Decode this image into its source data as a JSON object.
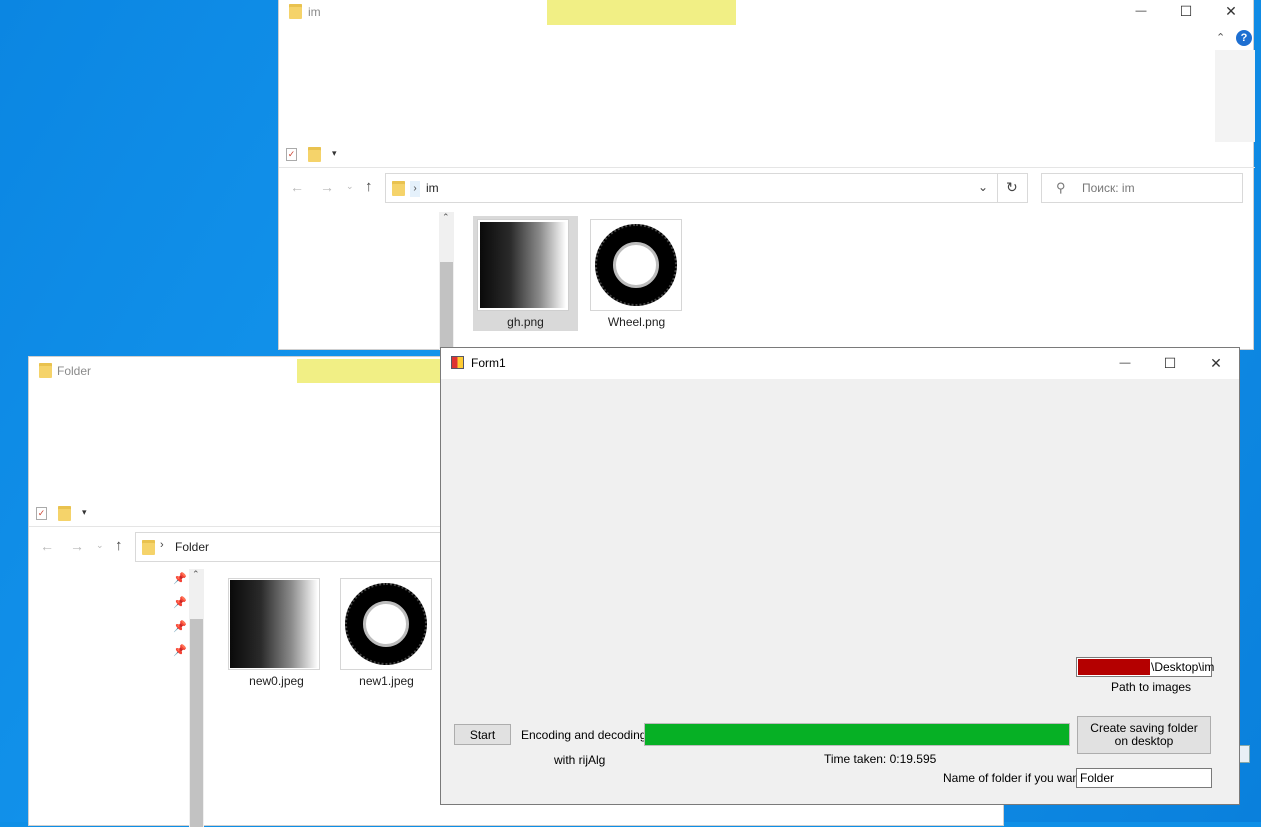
{
  "explorer_im": {
    "title": "im",
    "address_crumb": "im",
    "search_placeholder": "Поиск: im",
    "window_buttons": {
      "minimize": "—",
      "maximize": "☐",
      "close": "✕",
      "help": "?"
    },
    "files": [
      {
        "name": "gh.png"
      },
      {
        "name": "Wheel.png"
      }
    ]
  },
  "explorer_folder": {
    "title": "Folder",
    "address_crumb": "Folder",
    "files": [
      {
        "name": "new0.jpeg"
      },
      {
        "name": "new1.jpeg"
      }
    ]
  },
  "form1": {
    "title": "Form1",
    "window_buttons": {
      "minimize": "—",
      "maximize": "☐",
      "close": "✕"
    },
    "start_button": "Start",
    "encoding_label": "Encoding and decoding",
    "algorithm_label": "with rijAlg",
    "progress": 1.0,
    "time_taken_label": "Time taken: 0:19.595",
    "path_value": "\\Desktop\\im",
    "path_label": "Path to images",
    "create_folder_button": "Create saving folder on desktop",
    "folder_name_label": "Name of folder if you want",
    "folder_name_value": "Folder"
  },
  "colors": {
    "desktop": "#0f8fe6",
    "progress": "#06b025",
    "redacted": "#b40000",
    "highlight": "#f1ef85"
  },
  "icons": [
    "folder-icon",
    "properties-icon",
    "dropdown-arrow-icon",
    "back-arrow-icon",
    "forward-arrow-icon",
    "up-arrow-icon",
    "refresh-icon",
    "search-icon",
    "pin-icon",
    "form-app-icon"
  ]
}
